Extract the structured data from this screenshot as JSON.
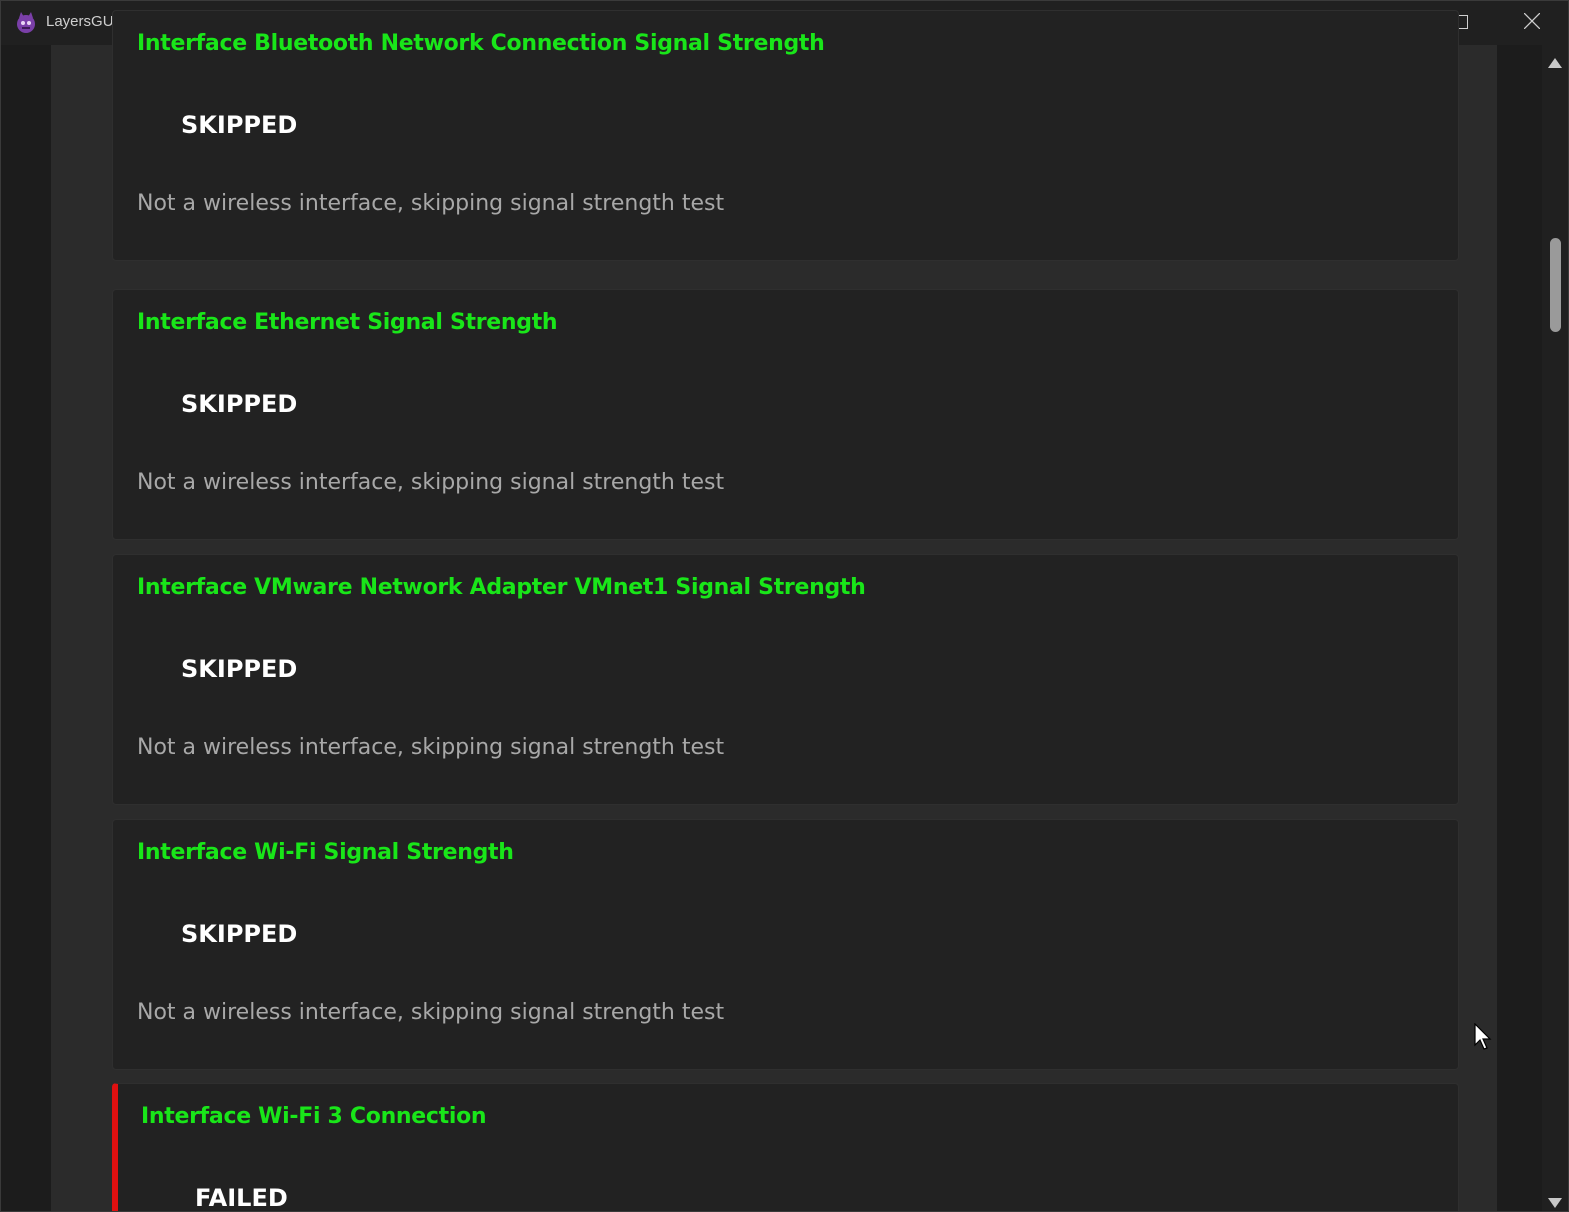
{
  "window": {
    "title": "LayersGUI",
    "app_icon": "layers-mascot-icon",
    "controls": [
      "minimize-icon",
      "maximize-icon",
      "close-icon"
    ]
  },
  "colors": {
    "title_green": "#19e619",
    "status_white": "#ffffff",
    "message_gray": "#a8a8a8",
    "failed_accent": "#e01010",
    "card_bg": "#222222",
    "content_bg": "#2b2b2b"
  },
  "results": [
    {
      "title": "Interface Bluetooth Network Connection Signal Strength",
      "status": "SKIPPED",
      "message": "Not a wireless interface, skipping signal strength test"
    },
    {
      "title": "Interface Ethernet Signal Strength",
      "status": "SKIPPED",
      "message": "Not a wireless interface, skipping signal strength test"
    },
    {
      "title": "Interface VMware Network Adapter VMnet1 Signal Strength",
      "status": "SKIPPED",
      "message": "Not a wireless interface, skipping signal strength test"
    },
    {
      "title": "Interface Wi-Fi Signal Strength",
      "status": "SKIPPED",
      "message": "Not a wireless interface, skipping signal strength test"
    },
    {
      "title": "Interface Wi-Fi 3 Connection",
      "status": "FAILED",
      "message": ""
    }
  ]
}
